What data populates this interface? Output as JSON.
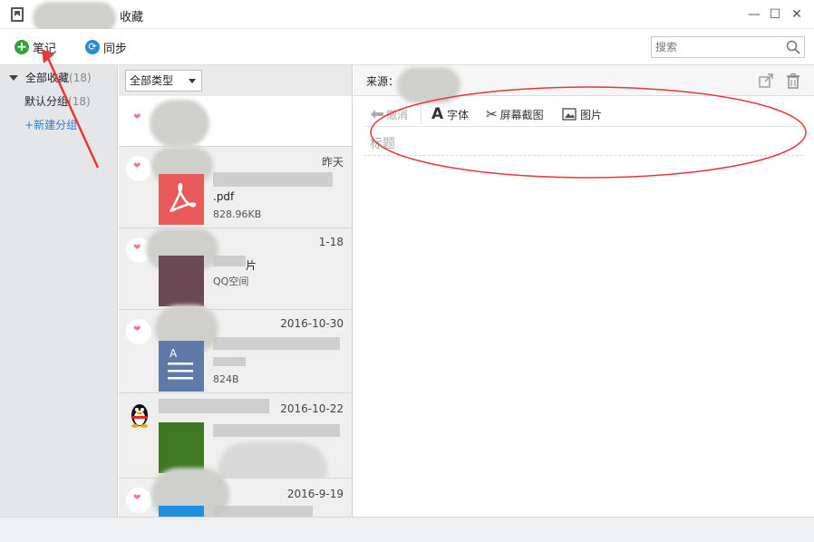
{
  "window": {
    "title": "收藏",
    "minimize": "—",
    "maximize": "☐",
    "close": "✕"
  },
  "toolbar": {
    "note_label": "笔记",
    "sync_label": "同步",
    "search_placeholder": "搜索"
  },
  "sidebar": {
    "items": [
      {
        "label": "全部收藏",
        "count": "(18)"
      },
      {
        "label": "默认分组",
        "count": "(18)"
      },
      {
        "label": "新建分组",
        "prefix": "+"
      }
    ]
  },
  "list": {
    "type_filter": "全部类型",
    "items": [
      {
        "date": "",
        "title": "",
        "sub": ""
      },
      {
        "date": "昨天",
        "title": ".pdf",
        "sub": "828.96KB"
      },
      {
        "date": "1-18",
        "title": "片",
        "sub": "QQ空间"
      },
      {
        "date": "2016-10-30",
        "title": "",
        "sub": "824B"
      },
      {
        "date": "2016-10-22",
        "title": "",
        "sub": ""
      },
      {
        "date": "2016-9-19",
        "title": "",
        "sub": ""
      }
    ]
  },
  "content": {
    "source_label": "来源：",
    "editor": {
      "undo": "撤消",
      "font": "字体",
      "screenshot": "屏幕截图",
      "image": "图片"
    },
    "title_placeholder": "标题"
  },
  "colors": {
    "accent_green": "#33a33b",
    "accent_blue": "#2d8ad8",
    "link_blue": "#2d7fd3",
    "annotation_red": "#e8363a"
  },
  "icons": {
    "app": "bookmark-icon",
    "note": "plus-circle-icon",
    "sync": "sync-icon",
    "search": "magnifier-icon",
    "share": "share-icon",
    "delete": "trash-icon",
    "undo": "undo-arrow-icon",
    "font": "font-a-icon",
    "screenshot": "scissors-icon",
    "image": "picture-icon"
  }
}
